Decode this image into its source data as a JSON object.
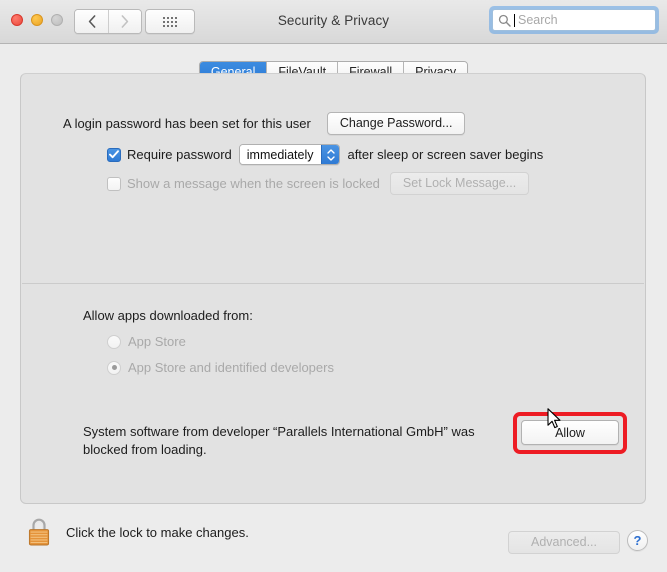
{
  "window": {
    "title": "Security & Privacy",
    "traffic_lights": [
      {
        "name": "close",
        "color": "#e9483b"
      },
      {
        "name": "minimize",
        "color": "#e9a426"
      },
      {
        "name": "zoom",
        "color": "#bdbdbd"
      }
    ],
    "nav": {
      "back_label": "‹",
      "forward_label": "›"
    },
    "show_all_label": "Show All"
  },
  "search": {
    "placeholder": "Search",
    "value": "",
    "focused": true
  },
  "tabs": [
    {
      "label": "General",
      "selected": true
    },
    {
      "label": "FileVault",
      "selected": false
    },
    {
      "label": "Firewall",
      "selected": false
    },
    {
      "label": "Privacy",
      "selected": false
    }
  ],
  "general": {
    "login_password_text": "A login password has been set for this user",
    "change_password_label": "Change Password...",
    "require_password": {
      "checked": true,
      "label_before": "Require password",
      "value": "immediately",
      "label_after": "after sleep or screen saver begins"
    },
    "lock_message": {
      "checked": false,
      "label": "Show a message when the screen is locked",
      "button_label": "Set Lock Message...",
      "disabled": true
    },
    "allow_apps": {
      "heading": "Allow apps downloaded from:",
      "options": [
        {
          "label": "App Store",
          "selected": false,
          "disabled": true
        },
        {
          "label": "App Store and identified developers",
          "selected": true,
          "disabled": true
        }
      ]
    },
    "blocked_software": {
      "message": "System software from developer “Parallels International GmbH” was blocked from loading.",
      "allow_label": "Allow",
      "highlight_color": "#ed1c24"
    }
  },
  "footer": {
    "lock_text": "Click the lock to make changes.",
    "lock_state": "locked",
    "advanced_label": "Advanced...",
    "advanced_disabled": true,
    "help_label": "?"
  },
  "colors": {
    "accent": "#2f7ad4",
    "window_bg": "#ececec",
    "pane_bg": "#e2e2e2",
    "annotation": "#ed1c24"
  }
}
